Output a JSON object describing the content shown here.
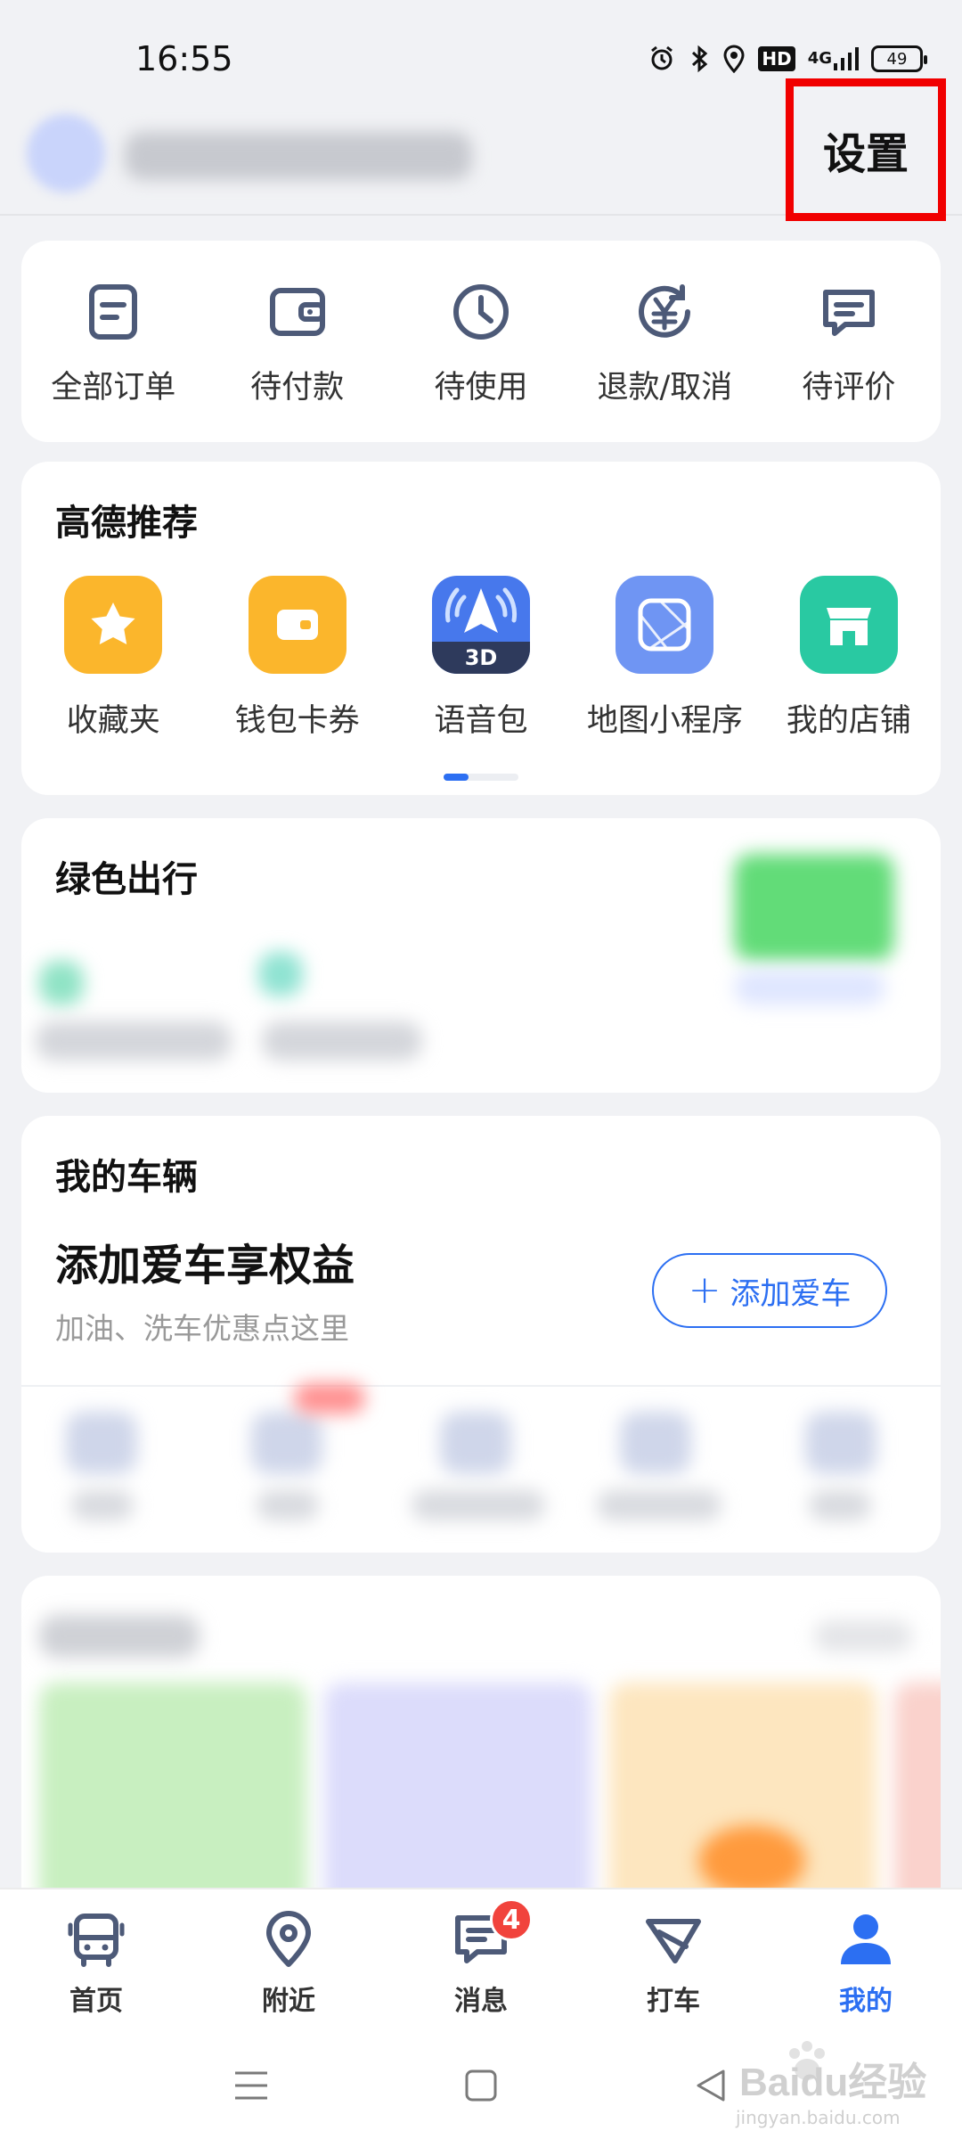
{
  "status_bar": {
    "time": "16:55",
    "hd": "HD",
    "network": "4G",
    "battery": "49"
  },
  "header": {
    "settings_label": "设置"
  },
  "orders": [
    {
      "label": "全部订单",
      "icon": "order-list-icon"
    },
    {
      "label": "待付款",
      "icon": "wallet-icon"
    },
    {
      "label": "待使用",
      "icon": "clock-icon"
    },
    {
      "label": "退款/取消",
      "icon": "refund-yuan-icon"
    },
    {
      "label": "待评价",
      "icon": "comment-icon"
    }
  ],
  "recommend": {
    "title": "高德推荐",
    "items": [
      {
        "label": "收藏夹",
        "icon": "star-icon",
        "color": "#fbb62c"
      },
      {
        "label": "钱包卡券",
        "icon": "wallet-card-icon",
        "color": "#fbb62c"
      },
      {
        "label": "语音包",
        "icon": "voice-3d-icon",
        "color": "#3e6fe0",
        "badge": "3D"
      },
      {
        "label": "地图小程序",
        "icon": "mini-program-icon",
        "color": "#6f95f3"
      },
      {
        "label": "我的店铺",
        "icon": "store-icon",
        "color": "#29c9a2"
      }
    ]
  },
  "green_travel": {
    "title": "绿色出行"
  },
  "vehicle": {
    "title": "我的车辆",
    "headline": "添加爱车享权益",
    "subtitle": "加油、洗车优惠点这里",
    "add_button": "添加爱车"
  },
  "bottom_nav": [
    {
      "label": "首页",
      "icon": "bus-icon"
    },
    {
      "label": "附近",
      "icon": "location-pin-icon"
    },
    {
      "label": "消息",
      "icon": "message-icon",
      "badge": "4"
    },
    {
      "label": "打车",
      "icon": "taxi-flag-icon"
    },
    {
      "label": "我的",
      "icon": "person-icon",
      "active": true
    }
  ],
  "watermark": {
    "brand": "Baidu经验",
    "url": "jingyan.baidu.com"
  },
  "colors": {
    "accent": "#2c6ff2",
    "highlight_box": "#f10000",
    "icon_gray": "#4d5a78"
  }
}
